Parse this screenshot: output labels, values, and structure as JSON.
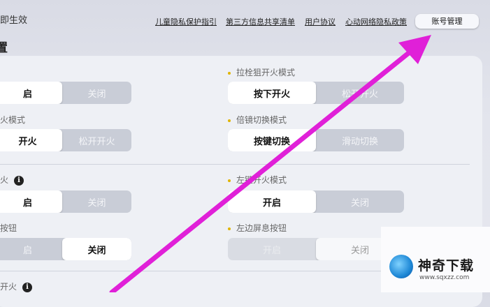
{
  "header": {
    "partial_text": "即生效",
    "page_title_partial": "置",
    "links": [
      {
        "label": "儿童隐私保护指引"
      },
      {
        "label": "第三方信息共享清单"
      },
      {
        "label": "用户协议"
      },
      {
        "label": "心动网络隐私政策"
      }
    ],
    "account_button": "账号管理"
  },
  "left": {
    "row1": {
      "options": [
        "启",
        "关闭"
      ],
      "selected": 0
    },
    "row2": {
      "label": "火模式",
      "options": [
        "开火",
        "松开开火"
      ],
      "selected": 0
    },
    "row3": {
      "label": "火",
      "options": [
        "启",
        "关闭"
      ],
      "selected": 0
    },
    "row4": {
      "label": "按钮",
      "options": [
        "启",
        "关闭"
      ],
      "selected": 1
    },
    "row5": {
      "label": "开火"
    }
  },
  "right": {
    "row1": {
      "label": "拉栓狙开火模式",
      "options": [
        "按下开火",
        "松开开火"
      ],
      "selected": 0
    },
    "row2": {
      "label": "倍镜切换模式",
      "options": [
        "按键切换",
        "滑动切换"
      ],
      "selected": 0
    },
    "row3": {
      "label": "左键开火模式",
      "options": [
        "开启",
        "关闭"
      ],
      "selected": 0
    },
    "row4": {
      "label": "左边屏息按钮",
      "options": [
        "开启",
        "关闭"
      ],
      "selected": 1
    }
  },
  "info_icon": "i",
  "watermark": {
    "title": "神奇下载",
    "url": "www.sqxzz.com"
  },
  "colors": {
    "annotation_arrow": "#e020d8",
    "bullet": "#e0b400"
  }
}
